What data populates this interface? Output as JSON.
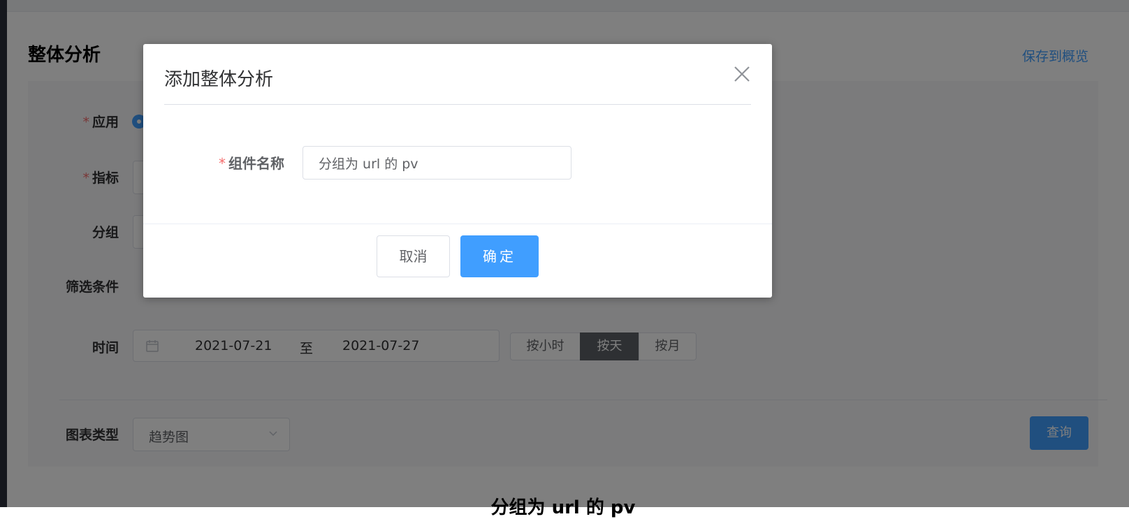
{
  "page": {
    "title": "整体分析",
    "save_link": "保存到概览"
  },
  "form": {
    "app_label": "应用",
    "metric_label": "指标",
    "group_label": "分组",
    "filter_label": "筛选条件",
    "time_label": "时间",
    "required_mark": "*",
    "date_start": "2021-07-21",
    "date_sep": "至",
    "date_end": "2021-07-27",
    "granularity": [
      {
        "label": "按小时",
        "active": false
      },
      {
        "label": "按天",
        "active": true
      },
      {
        "label": "按月",
        "active": false
      }
    ],
    "chart_type_label": "图表类型",
    "chart_type_value": "趋势图",
    "query_button": "查询"
  },
  "chart": {
    "title": "分组为 url 的 pv"
  },
  "dialog": {
    "title": "添加整体分析",
    "field_required_mark": "*",
    "field_label": "组件名称",
    "field_value": "分组为 url 的 pv",
    "cancel_button": "取消",
    "ok_button": "确定"
  },
  "colors": {
    "primary": "#409eff",
    "required": "#f56c6c",
    "active_segment": "#5d6066"
  }
}
